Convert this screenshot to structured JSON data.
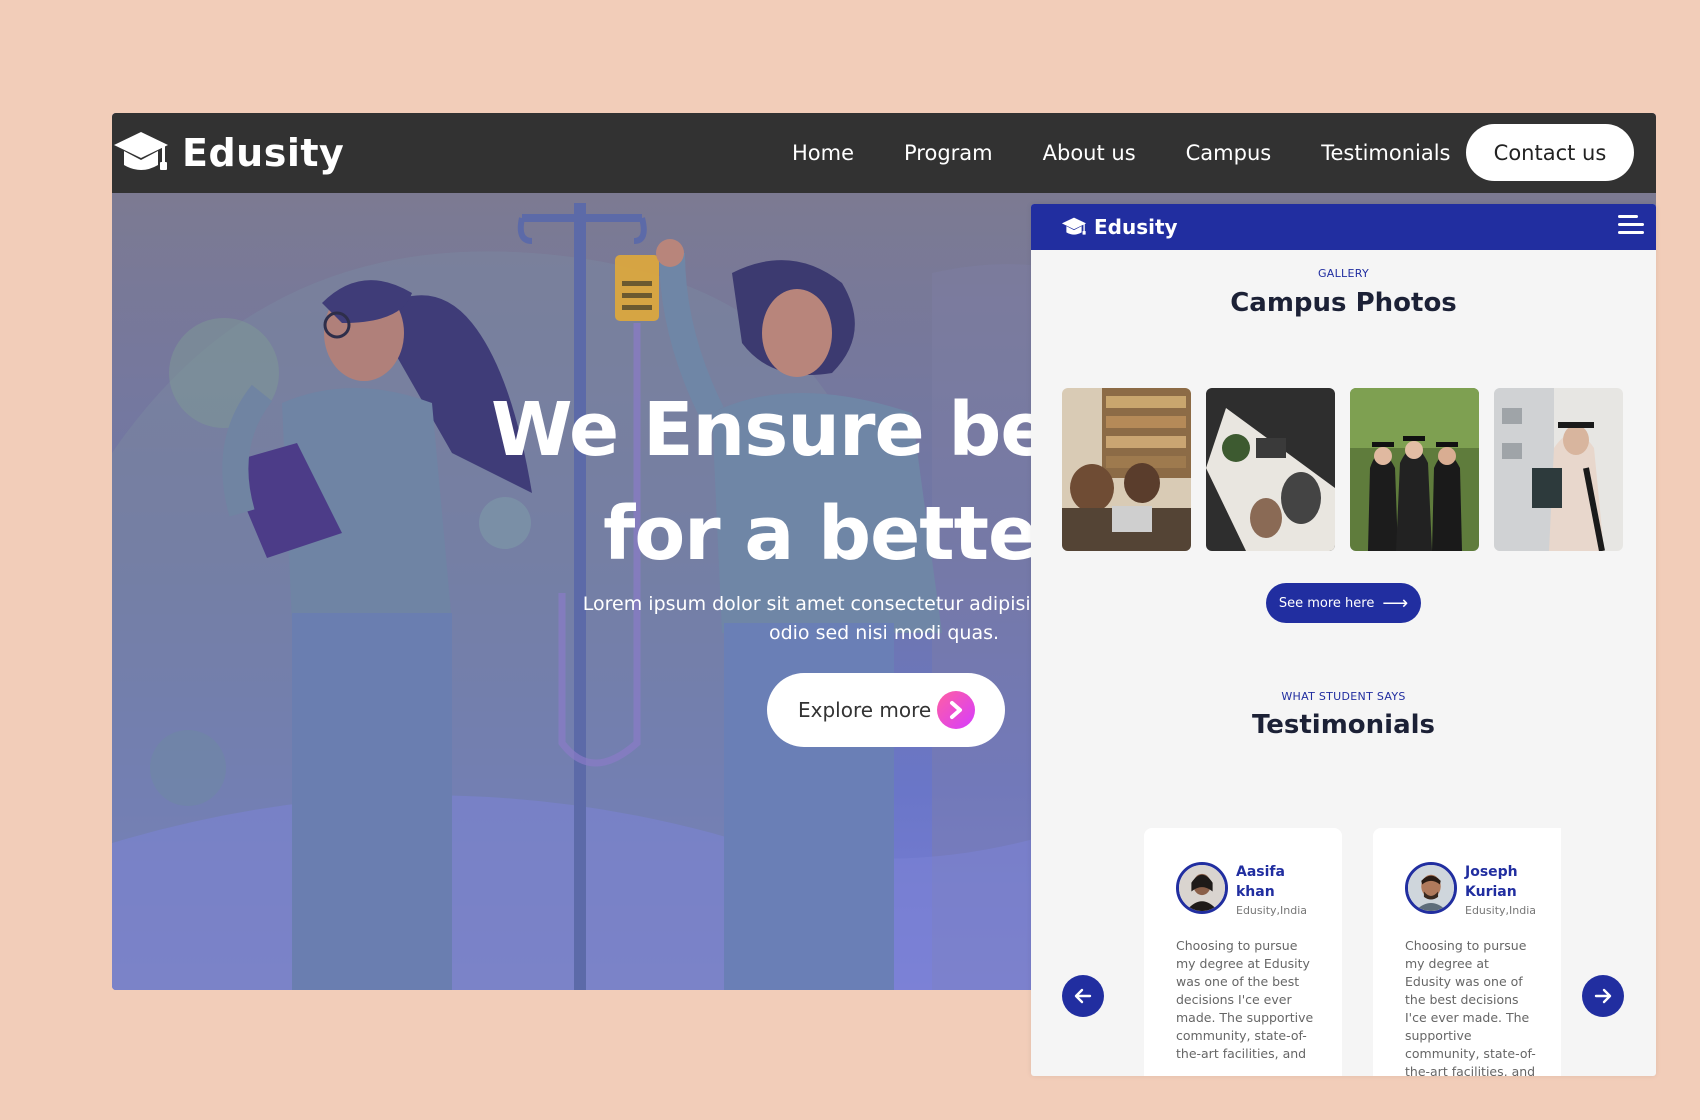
{
  "desktop": {
    "brand": "Edusity",
    "nav": [
      {
        "label": "Home"
      },
      {
        "label": "Program"
      },
      {
        "label": "About us"
      },
      {
        "label": "Campus"
      },
      {
        "label": "Testimonials"
      }
    ],
    "contact_label": "Contact us",
    "hero": {
      "title_line1": "We Ensure better e",
      "title_line2": "for a better w",
      "subtitle_line1": "Lorem ipsum dolor sit amet consectetur adipisicing elit. At dele",
      "subtitle_line2": "odio sed nisi modi quas.",
      "explore_label": "Explore more"
    }
  },
  "mobile": {
    "brand": "Edusity",
    "gallery": {
      "eyebrow": "GALLERY",
      "heading": "Campus Photos",
      "see_more_label": "See more here"
    },
    "testimonials": {
      "eyebrow": "WHAT STUDENT SAYS",
      "heading": "Testimonials",
      "items": [
        {
          "name": "Aasifa khan",
          "location": "Edusity,India",
          "text": "Choosing to pursue my degree at Edusity was one of the best decisions I'ce ever made. The supportive community, state-of-the-art facilities, and"
        },
        {
          "name": "Joseph Kurian",
          "location": "Edusity,India",
          "text": "Choosing to pursue my degree at Edusity was one of the best decisions I'ce ever made. The supportive community, state-of-the-art facilities, and"
        }
      ]
    }
  },
  "colors": {
    "background": "#f2cdb9",
    "nav_dark": "#323232",
    "brand_blue": "#212ea0",
    "explore_gradient_start": "#ff5fa2",
    "explore_gradient_end": "#d63cff"
  },
  "icons": {
    "logo": "graduation-cap-icon",
    "explore": "chevron-right-icon",
    "menu": "hamburger-menu-icon",
    "see_more": "arrow-right-icon",
    "prev": "arrow-left-icon",
    "next": "arrow-right-icon"
  }
}
